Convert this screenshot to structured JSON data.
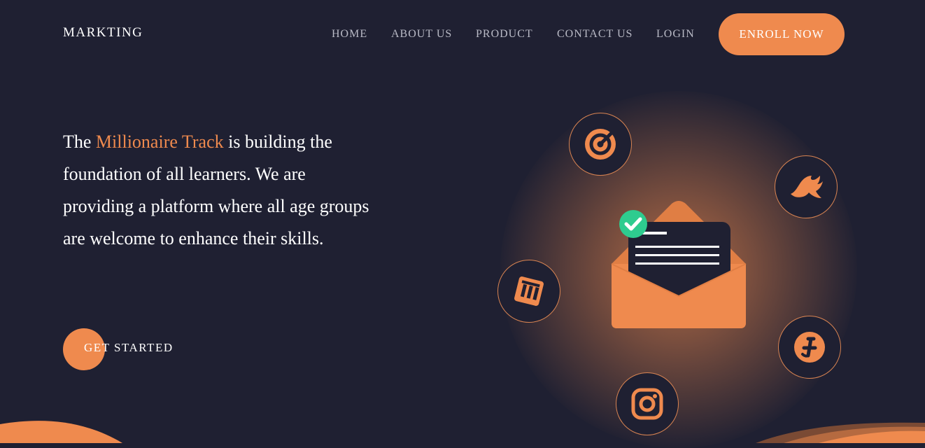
{
  "brand": {
    "logo": "MARKTING"
  },
  "nav": {
    "items": [
      {
        "label": "HOME"
      },
      {
        "label": "ABOUT US"
      },
      {
        "label": "PRODUCT"
      },
      {
        "label": "CONTACT US"
      },
      {
        "label": "LOGIN"
      }
    ],
    "cta_label": "ENROLL NOW"
  },
  "hero": {
    "text_before": "The ",
    "highlight": "Millionaire Track",
    "text_after": " is building the foundation of all learners. We are providing a platform where all age groups are welcome to enhance their skills.",
    "cta_label": "GET STARTED"
  },
  "colors": {
    "background": "#1f2032",
    "accent": "#ef8a4e",
    "nav_text": "#b9bac6",
    "check": "#2ecc8f"
  },
  "illustration": {
    "center": "envelope-icon",
    "icons": [
      "target-icon",
      "bird-icon",
      "shopping-bag-icon",
      "brand-icon",
      "instagram-icon"
    ]
  }
}
